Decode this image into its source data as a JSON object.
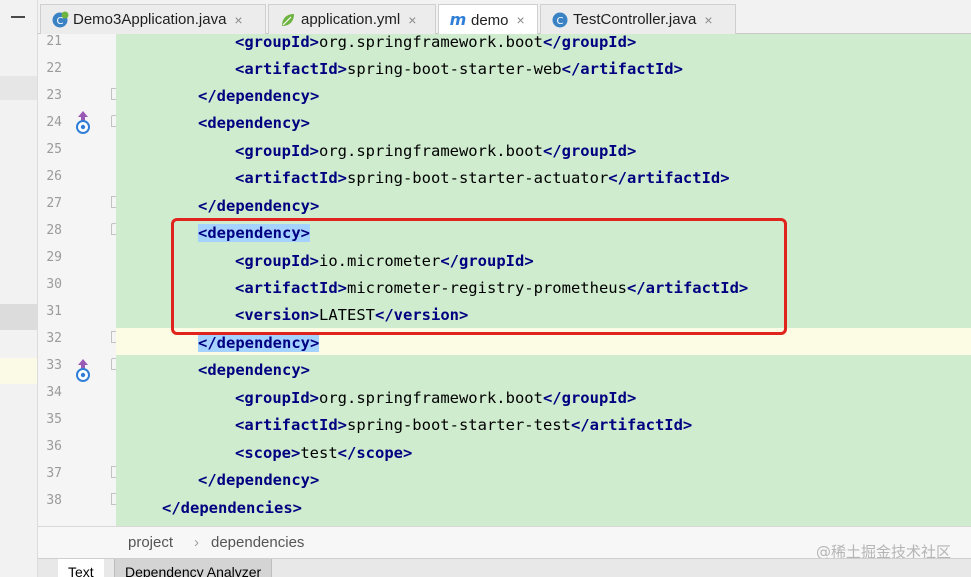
{
  "tabs": [
    {
      "label": "Demo3Application.java",
      "icon": "spring-class-icon",
      "active": false
    },
    {
      "label": "application.yml",
      "icon": "spring-leaf-icon",
      "active": false
    },
    {
      "label": "demo",
      "icon": "maven-icon",
      "active": true
    },
    {
      "label": "TestController.java",
      "icon": "class-icon",
      "active": false
    }
  ],
  "tab_close": "×",
  "line_numbers": [
    "21",
    "22",
    "23",
    "24",
    "25",
    "26",
    "27",
    "28",
    "29",
    "30",
    "31",
    "32",
    "33",
    "34",
    "35",
    "36",
    "37",
    "38"
  ],
  "code": {
    "l21": {
      "open": "<groupId>",
      "text": "org.springframework.boot",
      "close": "</groupId>"
    },
    "l22": {
      "open": "<artifactId>",
      "text": "spring-boot-starter-web",
      "close": "</artifactId>"
    },
    "l23": {
      "close": "</dependency>"
    },
    "l24": {
      "open": "<dependency>"
    },
    "l25": {
      "open": "<groupId>",
      "text": "org.springframework.boot",
      "close": "</groupId>"
    },
    "l26": {
      "open": "<artifactId>",
      "text": "spring-boot-starter-actuator",
      "close": "</artifactId>"
    },
    "l27": {
      "close": "</dependency>"
    },
    "l28": {
      "open": "<dependency>"
    },
    "l29": {
      "open": "<groupId>",
      "text": "io.micrometer",
      "close": "</groupId>"
    },
    "l30": {
      "open": "<artifactId>",
      "text": "micrometer-registry-prometheus",
      "close": "</artifactId>"
    },
    "l31": {
      "open": "<version>",
      "text": "LATEST",
      "close": "</version>"
    },
    "l32": {
      "close": "</dependency>"
    },
    "l33": {
      "open": "<dependency>"
    },
    "l34": {
      "open": "<groupId>",
      "text": "org.springframework.boot",
      "close": "</groupId>"
    },
    "l35": {
      "open": "<artifactId>",
      "text": "spring-boot-starter-test",
      "close": "</artifactId>"
    },
    "l36": {
      "open": "<scope>",
      "text": "test",
      "close": "</scope>"
    },
    "l37": {
      "close": "</dependency>"
    },
    "l38": {
      "close": "</dependencies>"
    }
  },
  "breadcrumb": {
    "items": [
      "project",
      "dependencies"
    ],
    "separator": "›"
  },
  "watermark": "@稀土掘金技术社区",
  "bottom_tabs": [
    "Text",
    "Dependency Analyzer"
  ],
  "colors": {
    "tag": "#000080",
    "highlight": "#a6d2ff",
    "added_bg": "#cfeccf",
    "annotation_box": "#e0231c"
  }
}
